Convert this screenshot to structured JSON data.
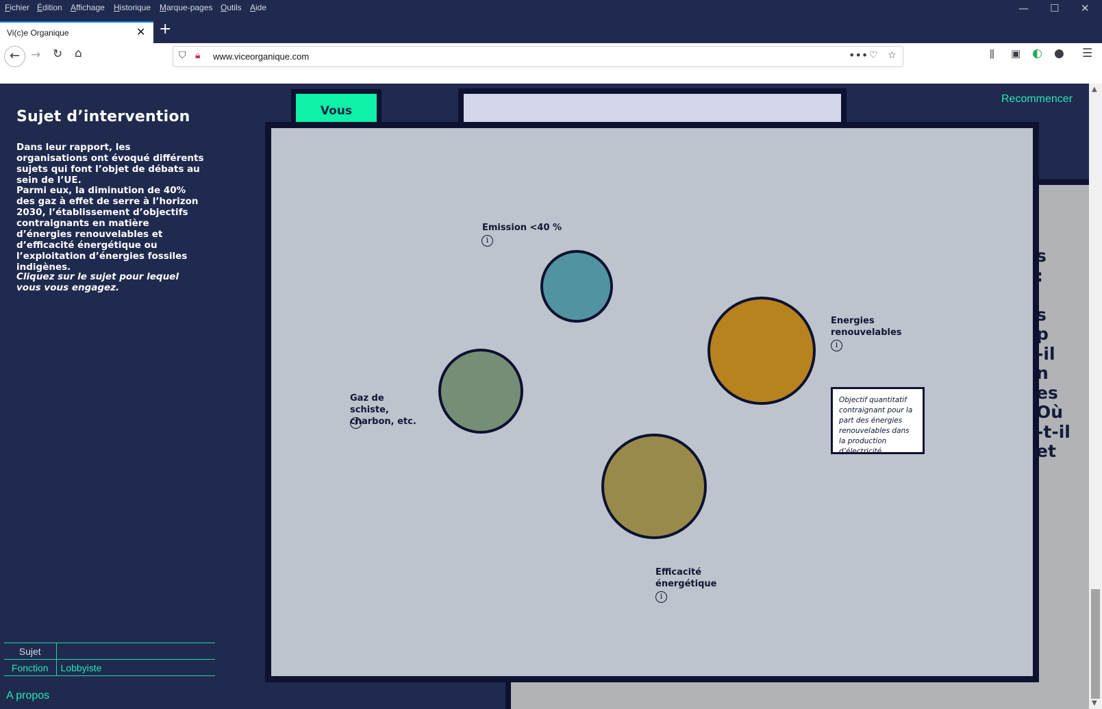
{
  "browser": {
    "menu": [
      "Fichier",
      "Édition",
      "Affichage",
      "Historique",
      "Marque-pages",
      "Outils",
      "Aide"
    ],
    "tab_title": "Vi(c)e Organique",
    "url": "www.viceorganique.com",
    "window_controls": {
      "minimize": "—",
      "maximize": "☐",
      "close": "✕"
    }
  },
  "sidebar": {
    "title": "Sujet d’intervention",
    "intro_1": "Dans leur rapport, les organisations ont évoqué différents sujets qui font l’objet de débats au sein de l’UE.",
    "intro_2": "Parmi eux, la diminution de 40% des gaz à effet de serre à l’horizon 2030, l’établissement d’objectifs contraignants en matière d’énergies renouvelables et d’efficacité énergétique ou l’exploitation d’énergies fossiles indigènes.",
    "instruction": "Cliquez sur le sujet pour lequel vous vous engagez.",
    "table": {
      "sujet_label": "Sujet",
      "sujet_value": "",
      "fonction_label": "Fonction",
      "fonction_value": "Lobbyiste"
    },
    "about": "A propos"
  },
  "header": {
    "restart": "Recommencer",
    "vous": "Vous"
  },
  "background_text": "s\n:\n\ns\np\n-il\nn\nes\nOù\n-t-il\net",
  "topics": [
    {
      "id": "emission",
      "label": "Emission <40 %",
      "color": "#5293a1"
    },
    {
      "id": "renouvelables",
      "label": "Energies renouvelables",
      "color": "#b8821e"
    },
    {
      "id": "schiste",
      "label": "Gaz de schiste, charbon, etc.",
      "color": "#778e76"
    },
    {
      "id": "efficacite",
      "label": "Efficacité énergétique",
      "color": "#998a4a"
    }
  ],
  "tooltip": "Objectif quantitatif contraignant pour la part des énergies renouvelables dans la production d’électricité",
  "colors": {
    "page_bg": "#1f2a4e",
    "accent": "#0ff0a8",
    "link": "#27e8b6",
    "modal_bg": "#bec4cd",
    "frame": "#0c1230"
  }
}
